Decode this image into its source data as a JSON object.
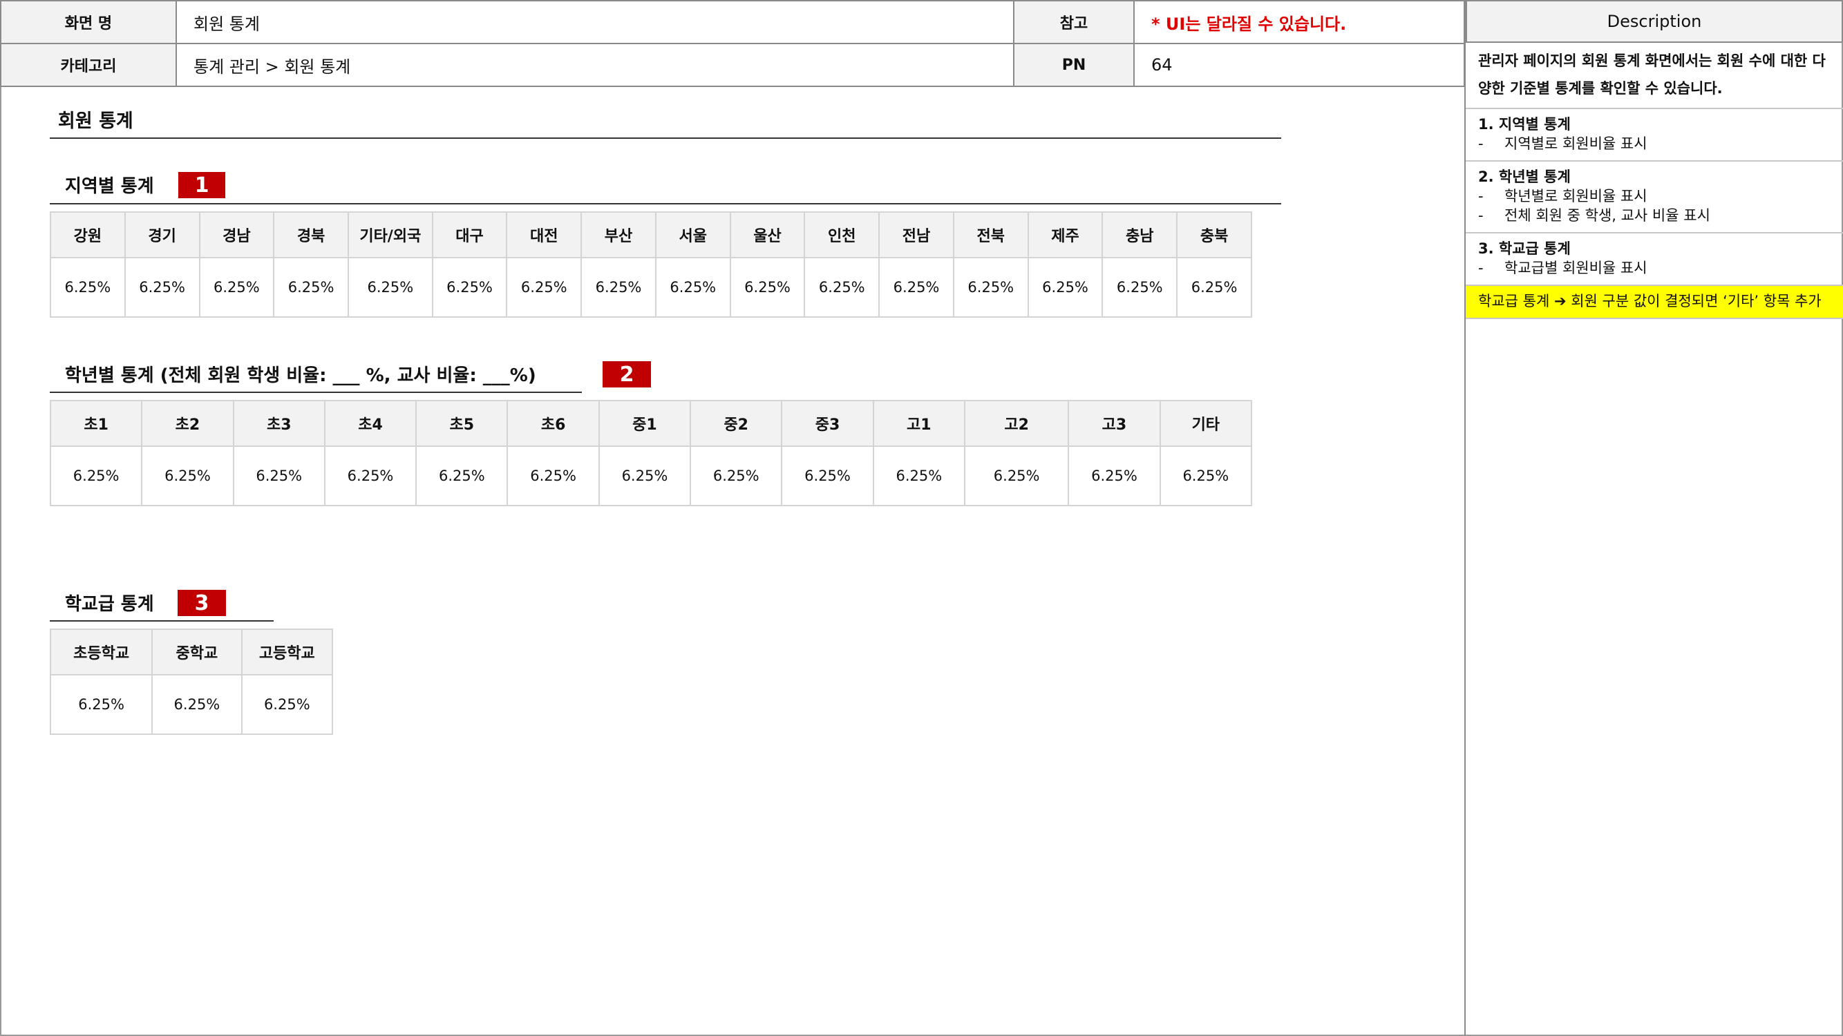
{
  "header": {
    "screen_name_label": "화면 명",
    "screen_name": "회원 통계",
    "reference_label": "참고",
    "reference_note": "* UI는 달라질 수 있습니다.",
    "category_label": "카테고리",
    "category": "통계 관리 > 회원 통계",
    "pn_label": "PN",
    "pn": "64"
  },
  "page_title": "회원 통계",
  "sections": {
    "region": {
      "title": "지역별 통계",
      "badge": "1",
      "columns": [
        "강원",
        "경기",
        "경남",
        "경북",
        "기타/외국",
        "대구",
        "대전",
        "부산",
        "서울",
        "울산",
        "인천",
        "전남",
        "전북",
        "제주",
        "충남",
        "충북"
      ],
      "values": [
        "6.25%",
        "6.25%",
        "6.25%",
        "6.25%",
        "6.25%",
        "6.25%",
        "6.25%",
        "6.25%",
        "6.25%",
        "6.25%",
        "6.25%",
        "6.25%",
        "6.25%",
        "6.25%",
        "6.25%",
        "6.25%"
      ]
    },
    "grade": {
      "title": "학년별 통계 (전체 회원 학생 비율: ___ %, 교사 비율: ___%)",
      "badge": "2",
      "columns": [
        "초1",
        "초2",
        "초3",
        "초4",
        "초5",
        "초6",
        "중1",
        "중2",
        "중3",
        "고1",
        "고2",
        "고3",
        "기타"
      ],
      "values": [
        "6.25%",
        "6.25%",
        "6.25%",
        "6.25%",
        "6.25%",
        "6.25%",
        "6.25%",
        "6.25%",
        "6.25%",
        "6.25%",
        "6.25%",
        "6.25%",
        "6.25%"
      ]
    },
    "school": {
      "title": "학교급 통계",
      "badge": "3",
      "columns": [
        "초등학교",
        "중학교",
        "고등학교"
      ],
      "values": [
        "6.25%",
        "6.25%",
        "6.25%"
      ]
    }
  },
  "description": {
    "title": "Description",
    "intro": "관리자 페이지의 회원 통계 화면에서는 회원 수에 대한 다양한 기준별 통계를 확인할 수 있습니다.",
    "items": [
      {
        "heading": "1. 지역별 통계",
        "bullets": [
          "지역별로 회원비율 표시"
        ]
      },
      {
        "heading": "2. 학년별 통계",
        "bullets": [
          "학년별로 회원비율 표시",
          "전체 회원 중 학생, 교사 비율 표시"
        ]
      },
      {
        "heading": "3. 학교급 통계",
        "bullets": [
          "학교급별 회원비율 표시"
        ]
      }
    ],
    "bullet_marker": "-",
    "highlight": "학교급 통계 ➔ 회원 구분 값이 결정되면 ‘기타’ 항목 추가",
    "highlight_color": "#ffff00"
  },
  "colors": {
    "badge": "#c00000",
    "note": "#e00000",
    "header_bg": "#f2f2f2"
  }
}
